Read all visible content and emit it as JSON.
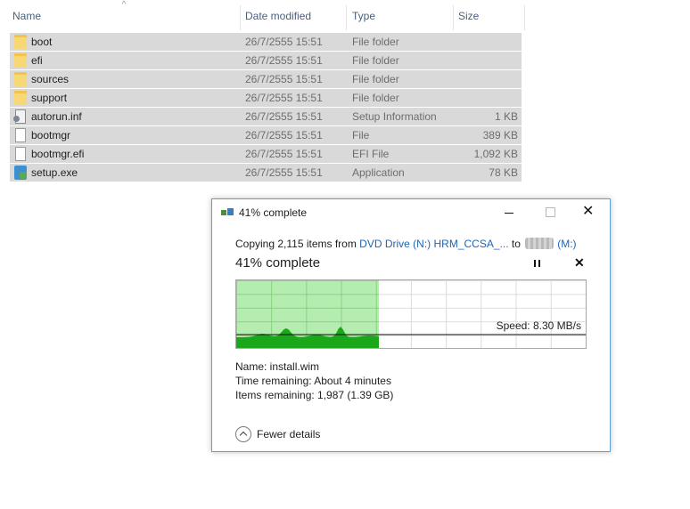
{
  "explorer": {
    "columns": {
      "name": "Name",
      "date": "Date modified",
      "type": "Type",
      "size": "Size"
    },
    "sort_indicator": "^",
    "files": [
      {
        "name": "boot",
        "date": "26/7/2555 15:51",
        "type": "File folder",
        "size": "",
        "icon": "folder-icon"
      },
      {
        "name": "efi",
        "date": "26/7/2555 15:51",
        "type": "File folder",
        "size": "",
        "icon": "folder-icon"
      },
      {
        "name": "sources",
        "date": "26/7/2555 15:51",
        "type": "File folder",
        "size": "",
        "icon": "folder-icon"
      },
      {
        "name": "support",
        "date": "26/7/2555 15:51",
        "type": "File folder",
        "size": "",
        "icon": "folder-icon"
      },
      {
        "name": "autorun.inf",
        "date": "26/7/2555 15:51",
        "type": "Setup Information",
        "size": "1 KB",
        "icon": "setup-info-icon"
      },
      {
        "name": "bootmgr",
        "date": "26/7/2555 15:51",
        "type": "File",
        "size": "389 KB",
        "icon": "file-icon"
      },
      {
        "name": "bootmgr.efi",
        "date": "26/7/2555 15:51",
        "type": "EFI File",
        "size": "1,092 KB",
        "icon": "file-icon"
      },
      {
        "name": "setup.exe",
        "date": "26/7/2555 15:51",
        "type": "Application",
        "size": "78 KB",
        "icon": "application-icon"
      }
    ]
  },
  "dialog": {
    "title": "41% complete",
    "copy_prefix": "Copying 2,115 items from ",
    "source": "DVD Drive (N:) HRM_CCSA_...",
    "to_word": " to ",
    "destination_drive": "(M:)",
    "status": "41% complete",
    "progress_fraction": 0.41,
    "speed": "Speed: 8.30 MB/s",
    "name_line": "Name:  install.wim",
    "time_line": "Time remaining:  About 4 minutes",
    "items_line": "Items remaining:  1,987 (1.39 GB)",
    "fewer_details": "Fewer details",
    "colors": {
      "graph_fill": "#78dc6e",
      "graph_throughput": "#1aa81a",
      "link": "#1e66b4"
    }
  }
}
